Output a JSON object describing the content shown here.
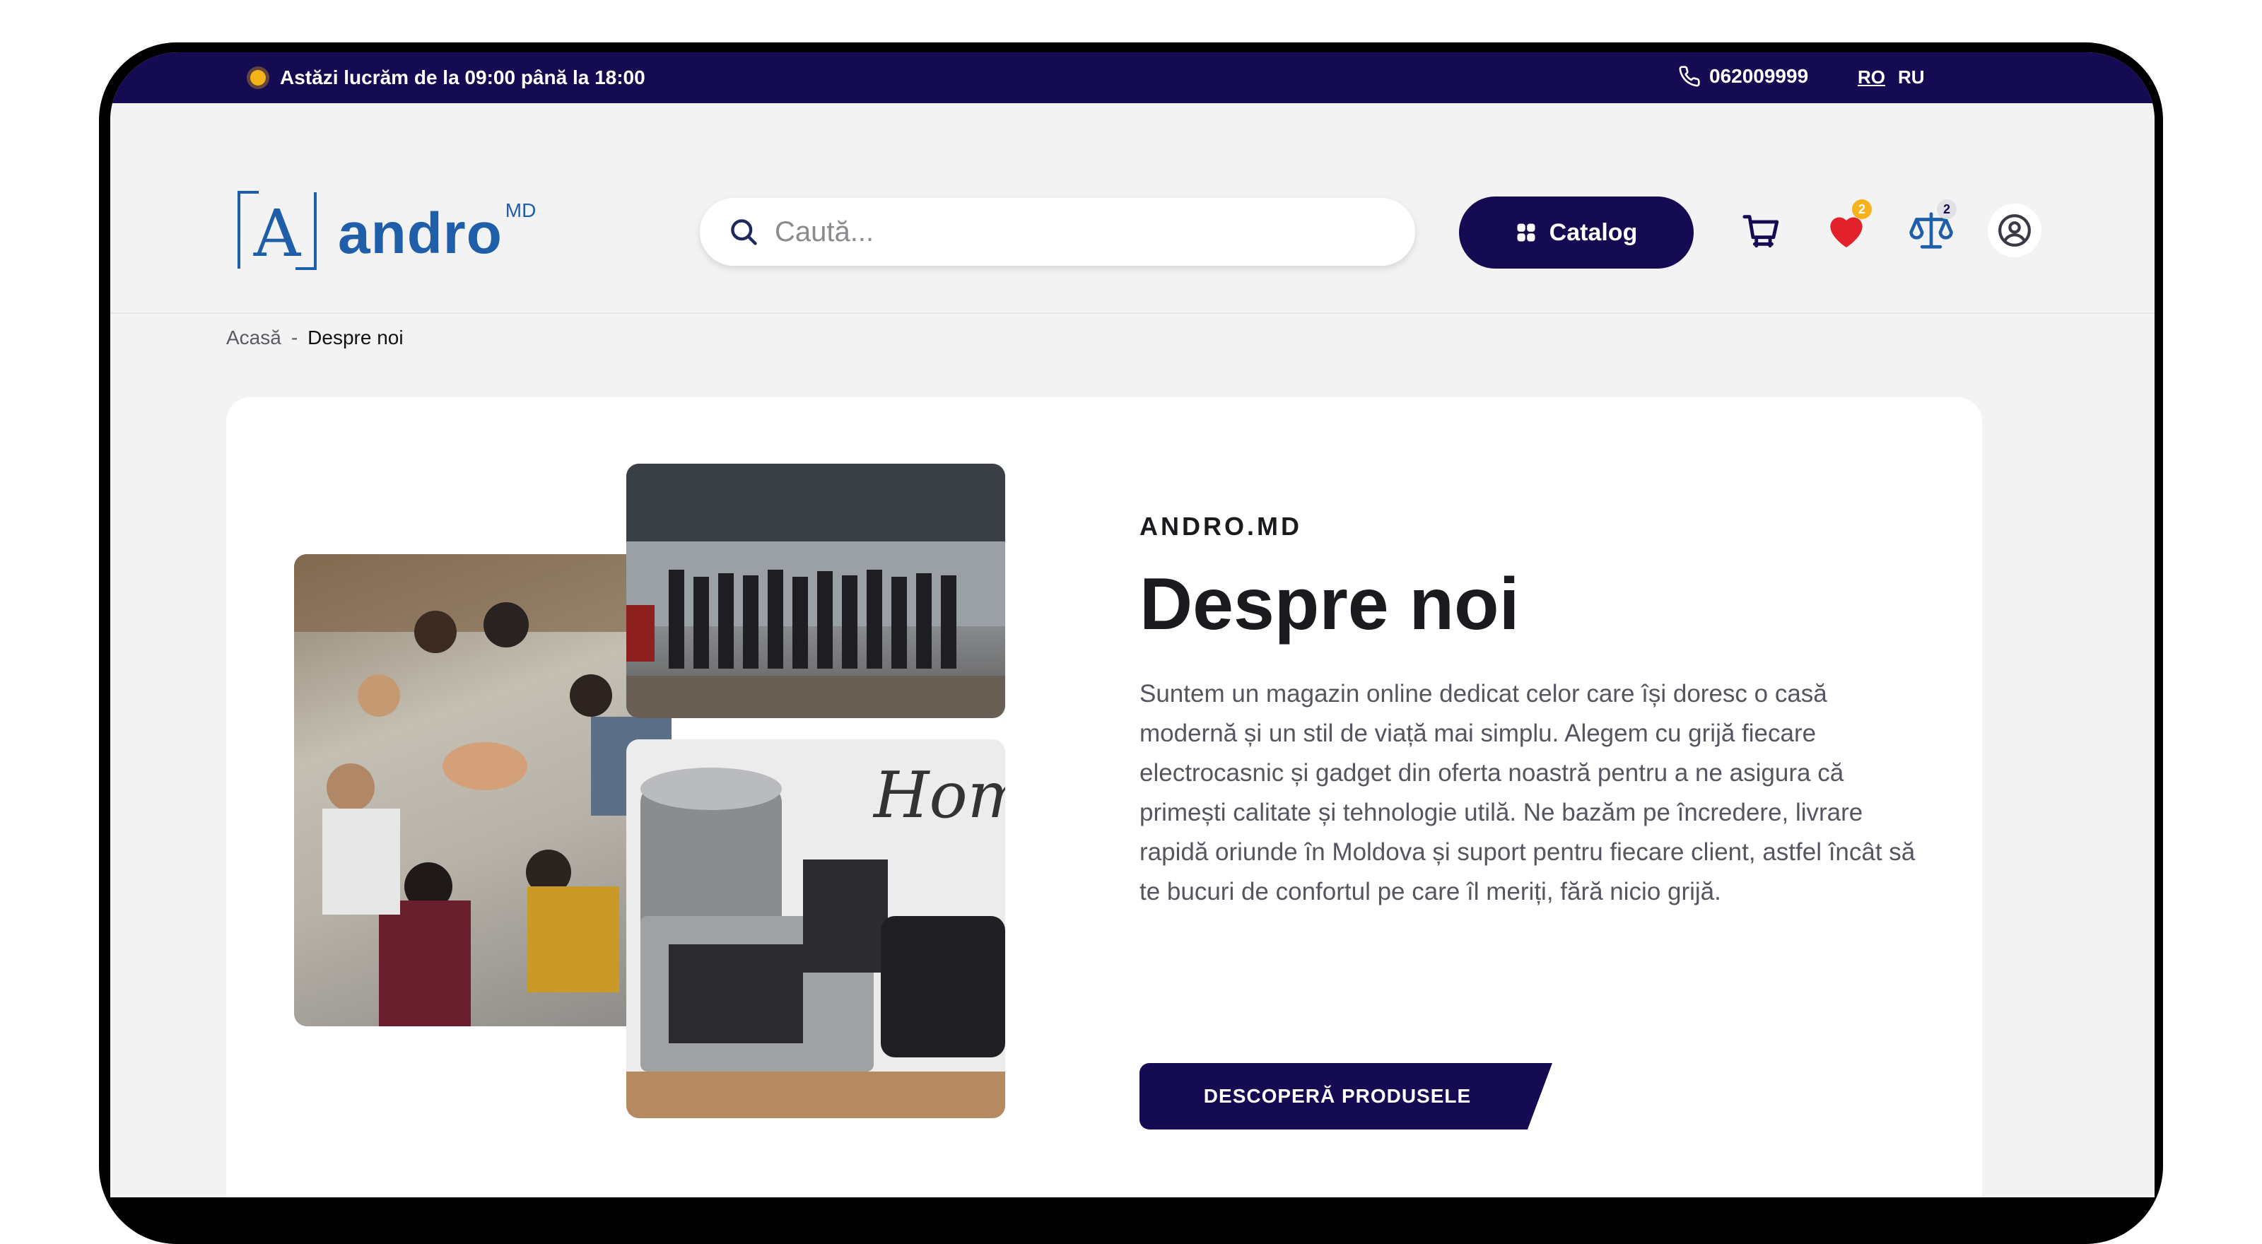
{
  "topbar": {
    "hours": "Astăzi lucrăm de la 09:00 până la 18:00",
    "phone": "062009999",
    "languages": [
      "RO",
      "RU"
    ],
    "active_language": "RO"
  },
  "header": {
    "logo_text": "andro",
    "logo_sup": "MD",
    "search_placeholder": "Caută...",
    "catalog_label": "Catalog",
    "wishlist_count": "2",
    "compare_count": "2"
  },
  "breadcrumb": {
    "home": "Acasă",
    "separator": "-",
    "current": "Despre noi"
  },
  "about": {
    "eyebrow": "ANDRO.MD",
    "title": "Despre noi",
    "description": "Suntem un magazin online dedicat celor care își doresc o casă modernă și un stil de viață mai simplu. Alegem cu grijă fiecare electrocasnic și gadget din oferta noastră pentru a ne asigura că primești calitate și tehnologie utilă. Ne bazăm pe încredere, livrare rapidă oriunde în Moldova și suport pentru fiecare client, astfel încât să te bucuri de confortul pe care îl meriți, fără nicio grijă.",
    "cta_label": "DESCOPERĂ PRODUSELE"
  },
  "colors": {
    "brand_dark": "#140b52",
    "logo_blue": "#1f5ea8",
    "accent_yellow": "#f5b21b",
    "heart_red": "#e3212b"
  },
  "icons": [
    "clock-dot-icon",
    "phone-icon",
    "search-icon",
    "grid-icon",
    "cart-icon",
    "heart-icon",
    "compare-scale-icon",
    "user-icon"
  ]
}
